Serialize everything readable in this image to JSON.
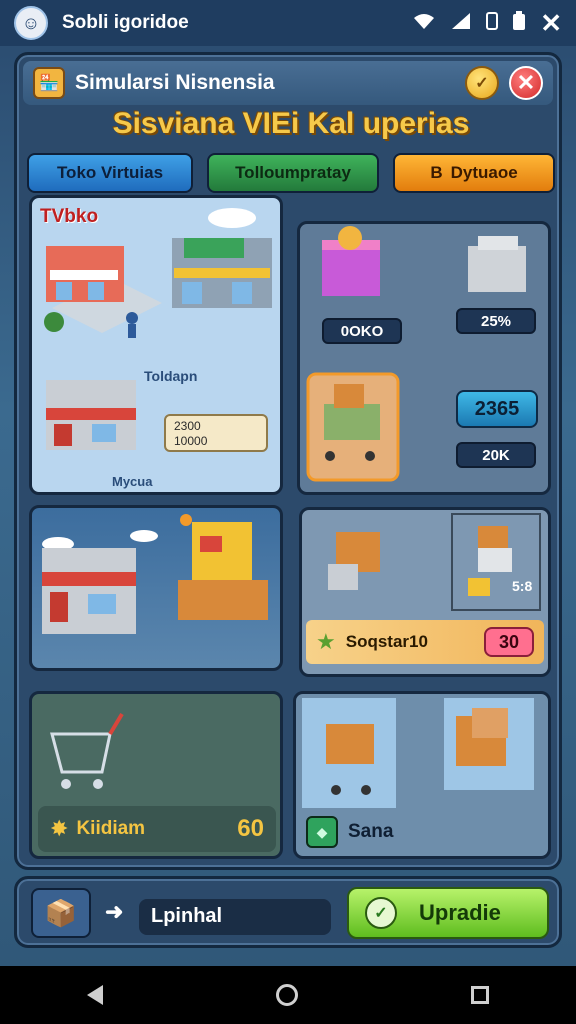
{
  "status_bar": {
    "app_name": "Sobli igoridoe",
    "avatar_icon": "user-avatar-icon",
    "close_glyph": "✕"
  },
  "panel": {
    "title": "Simularsi Nisnensia",
    "banner": "Sisviana VIEi Kal uperias",
    "tabs": [
      {
        "label": "Toko Virtuias"
      },
      {
        "label": "Tolloumpratay"
      },
      {
        "prefix": "B",
        "label": "Dytuaoe"
      }
    ]
  },
  "cards": {
    "store_scene": {
      "title": "TVbko",
      "sign_1": "Toldapn",
      "stats": [
        "2300",
        "10000"
      ],
      "sign_2": "Mycua"
    },
    "market_items": {
      "price_1": "0OKO",
      "price_2": "25%",
      "big_value": "2365",
      "price_3": "20K"
    },
    "goods": {
      "side_value": "5:8",
      "bar_label": "Soqstar10",
      "bar_value": "30"
    },
    "cart": {
      "label": "Kiidiam",
      "value": "60"
    },
    "sale": {
      "label": "Sana"
    }
  },
  "footer": {
    "field_text": "Lpinhal",
    "upgrade_label": "Upradie"
  },
  "colors": {
    "accent_gold": "#f6c94a",
    "upgrade_green": "#5fbd1f",
    "tab_blue": "#1f6cbd",
    "tab_green": "#237a3b",
    "tab_orange": "#e27d0d"
  }
}
